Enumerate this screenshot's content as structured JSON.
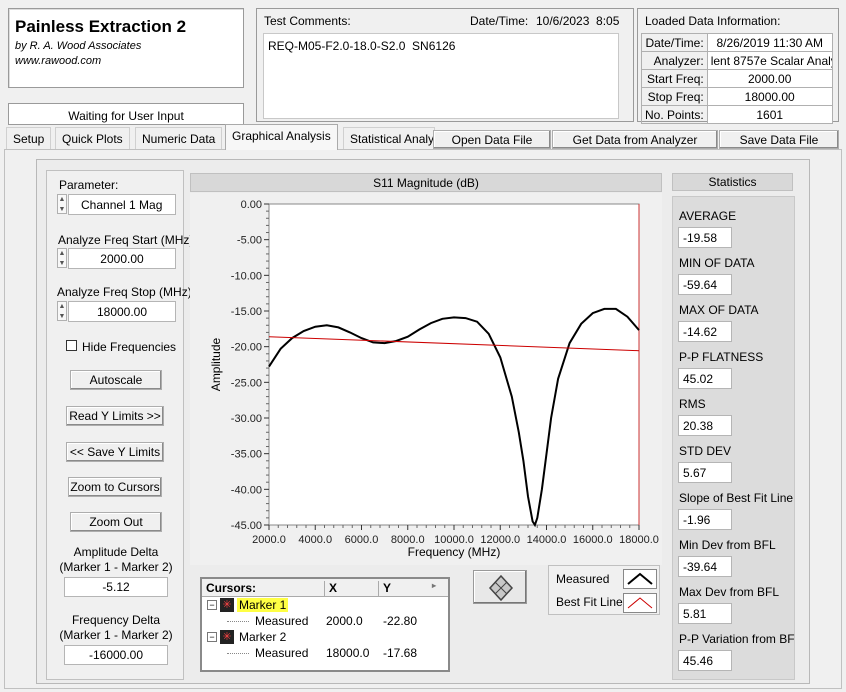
{
  "app": {
    "title": "Painless Extraction 2",
    "author": "by R. A. Wood Associates",
    "website": "www.rawood.com",
    "status": "Waiting for User Input"
  },
  "comments": {
    "label": "Test Comments:",
    "datetime_label": "Date/Time:",
    "datetime_value": "10/6/2023  8:05",
    "text": "REQ-M05-F2.0-18.0-S2.0  SN6126"
  },
  "loaded": {
    "title": "Loaded Data Information:",
    "rows": [
      {
        "k": "Date/Time:",
        "v": "8/26/2019 11:30 AM"
      },
      {
        "k": "Analyzer:",
        "v": "lent 8757e Scalar Analy"
      },
      {
        "k": "Start Freq:",
        "v": "2000.00"
      },
      {
        "k": "Stop Freq:",
        "v": "18000.00"
      },
      {
        "k": "No. Points:",
        "v": "1601"
      }
    ]
  },
  "tabs": [
    "Setup",
    "Quick Plots",
    "Numeric Data",
    "Graphical Analysis",
    "Statistical Analy"
  ],
  "toolbar": {
    "open": "Open Data File",
    "get": "Get Data from Analyzer",
    "save": "Save Data File"
  },
  "left": {
    "parameter_label": "Parameter:",
    "parameter_value": "Channel 1 Mag",
    "start_label": "Analyze Freq Start (MHz)",
    "start_value": "2000.00",
    "stop_label": "Analyze Freq Stop (MHz)",
    "stop_value": "18000.00",
    "hide_freq": "Hide Frequencies",
    "autoscale": "Autoscale",
    "read_y": "Read Y Limits >>",
    "save_y": "<< Save Y Limits",
    "zoom_cursors": "Zoom to Cursors",
    "zoom_out": "Zoom Out",
    "amp_delta_label1": "Amplitude Delta",
    "amp_delta_label2": "(Marker 1 - Marker 2)",
    "amp_delta_value": "-5.12",
    "freq_delta_label1": "Frequency Delta",
    "freq_delta_label2": "(Marker 1 - Marker 2)",
    "freq_delta_value": "-16000.00"
  },
  "chart_data": {
    "type": "line",
    "title": "S11 Magnitude (dB)",
    "xlabel": "Frequency (MHz)",
    "ylabel": "Amplitude",
    "xlim": [
      2000,
      18000
    ],
    "ylim": [
      -45,
      0
    ],
    "x_ticks": [
      "2000.0",
      "4000.0",
      "6000.0",
      "8000.0",
      "10000.0",
      "12000.0",
      "14000.0",
      "16000.0",
      "18000.0"
    ],
    "y_ticks": [
      "0.00",
      "-5.00",
      "-10.00",
      "-15.00",
      "-20.00",
      "-25.00",
      "-30.00",
      "-35.00",
      "-40.00",
      "-45.00"
    ],
    "series": [
      {
        "name": "Measured",
        "color": "#000000",
        "x": [
          2000,
          2500,
          3000,
          3500,
          4000,
          4500,
          5000,
          5500,
          6000,
          6500,
          7000,
          7500,
          8000,
          8500,
          9000,
          9500,
          10000,
          10500,
          11000,
          11500,
          12000,
          12500,
          12800,
          13000,
          13200,
          13400,
          13500,
          13600,
          13800,
          14000,
          14200,
          14500,
          15000,
          15500,
          16000,
          16500,
          17000,
          17500,
          18000
        ],
        "y": [
          -22.8,
          -20.3,
          -18.8,
          -17.8,
          -17.2,
          -17.0,
          -17.3,
          -18.0,
          -18.8,
          -19.4,
          -19.5,
          -19.2,
          -18.6,
          -17.6,
          -16.7,
          -16.1,
          -15.9,
          -16.0,
          -16.5,
          -18.2,
          -21.5,
          -27,
          -32,
          -36,
          -41,
          -44.5,
          -45,
          -44,
          -40,
          -35,
          -30,
          -24.5,
          -19.5,
          -16.8,
          -15.3,
          -14.7,
          -14.7,
          -15.8,
          -17.68
        ]
      },
      {
        "name": "Best Fit Line",
        "color": "#cc0000",
        "x": [
          2000,
          18000
        ],
        "y": [
          -18.6,
          -20.56
        ]
      }
    ]
  },
  "statistics": {
    "title": "Statistics",
    "items": [
      {
        "label": "AVERAGE",
        "value": "-19.58"
      },
      {
        "label": "MIN OF DATA",
        "value": "-59.64"
      },
      {
        "label": "MAX OF DATA",
        "value": "-14.62"
      },
      {
        "label": "P-P FLATNESS",
        "value": "45.02"
      },
      {
        "label": "RMS",
        "value": "20.38"
      },
      {
        "label": "STD DEV",
        "value": "5.67"
      },
      {
        "label": "Slope of Best Fit Line",
        "value": "-1.96"
      },
      {
        "label": "Min Dev from BFL",
        "value": "-39.64"
      },
      {
        "label": "Max Dev from BFL",
        "value": "5.81"
      },
      {
        "label": "P-P Variation from BF",
        "value": "45.46"
      }
    ]
  },
  "cursors": {
    "headers": [
      "Cursors:",
      "X",
      "Y"
    ],
    "marker1": "Marker 1",
    "marker2": "Marker 2",
    "measured": "Measured",
    "m1x": "2000.0",
    "m1y": "-22.80",
    "m2x": "18000.0",
    "m2y": "-17.68"
  },
  "legend": {
    "measured": "Measured",
    "bfl": "Best Fit Line"
  }
}
